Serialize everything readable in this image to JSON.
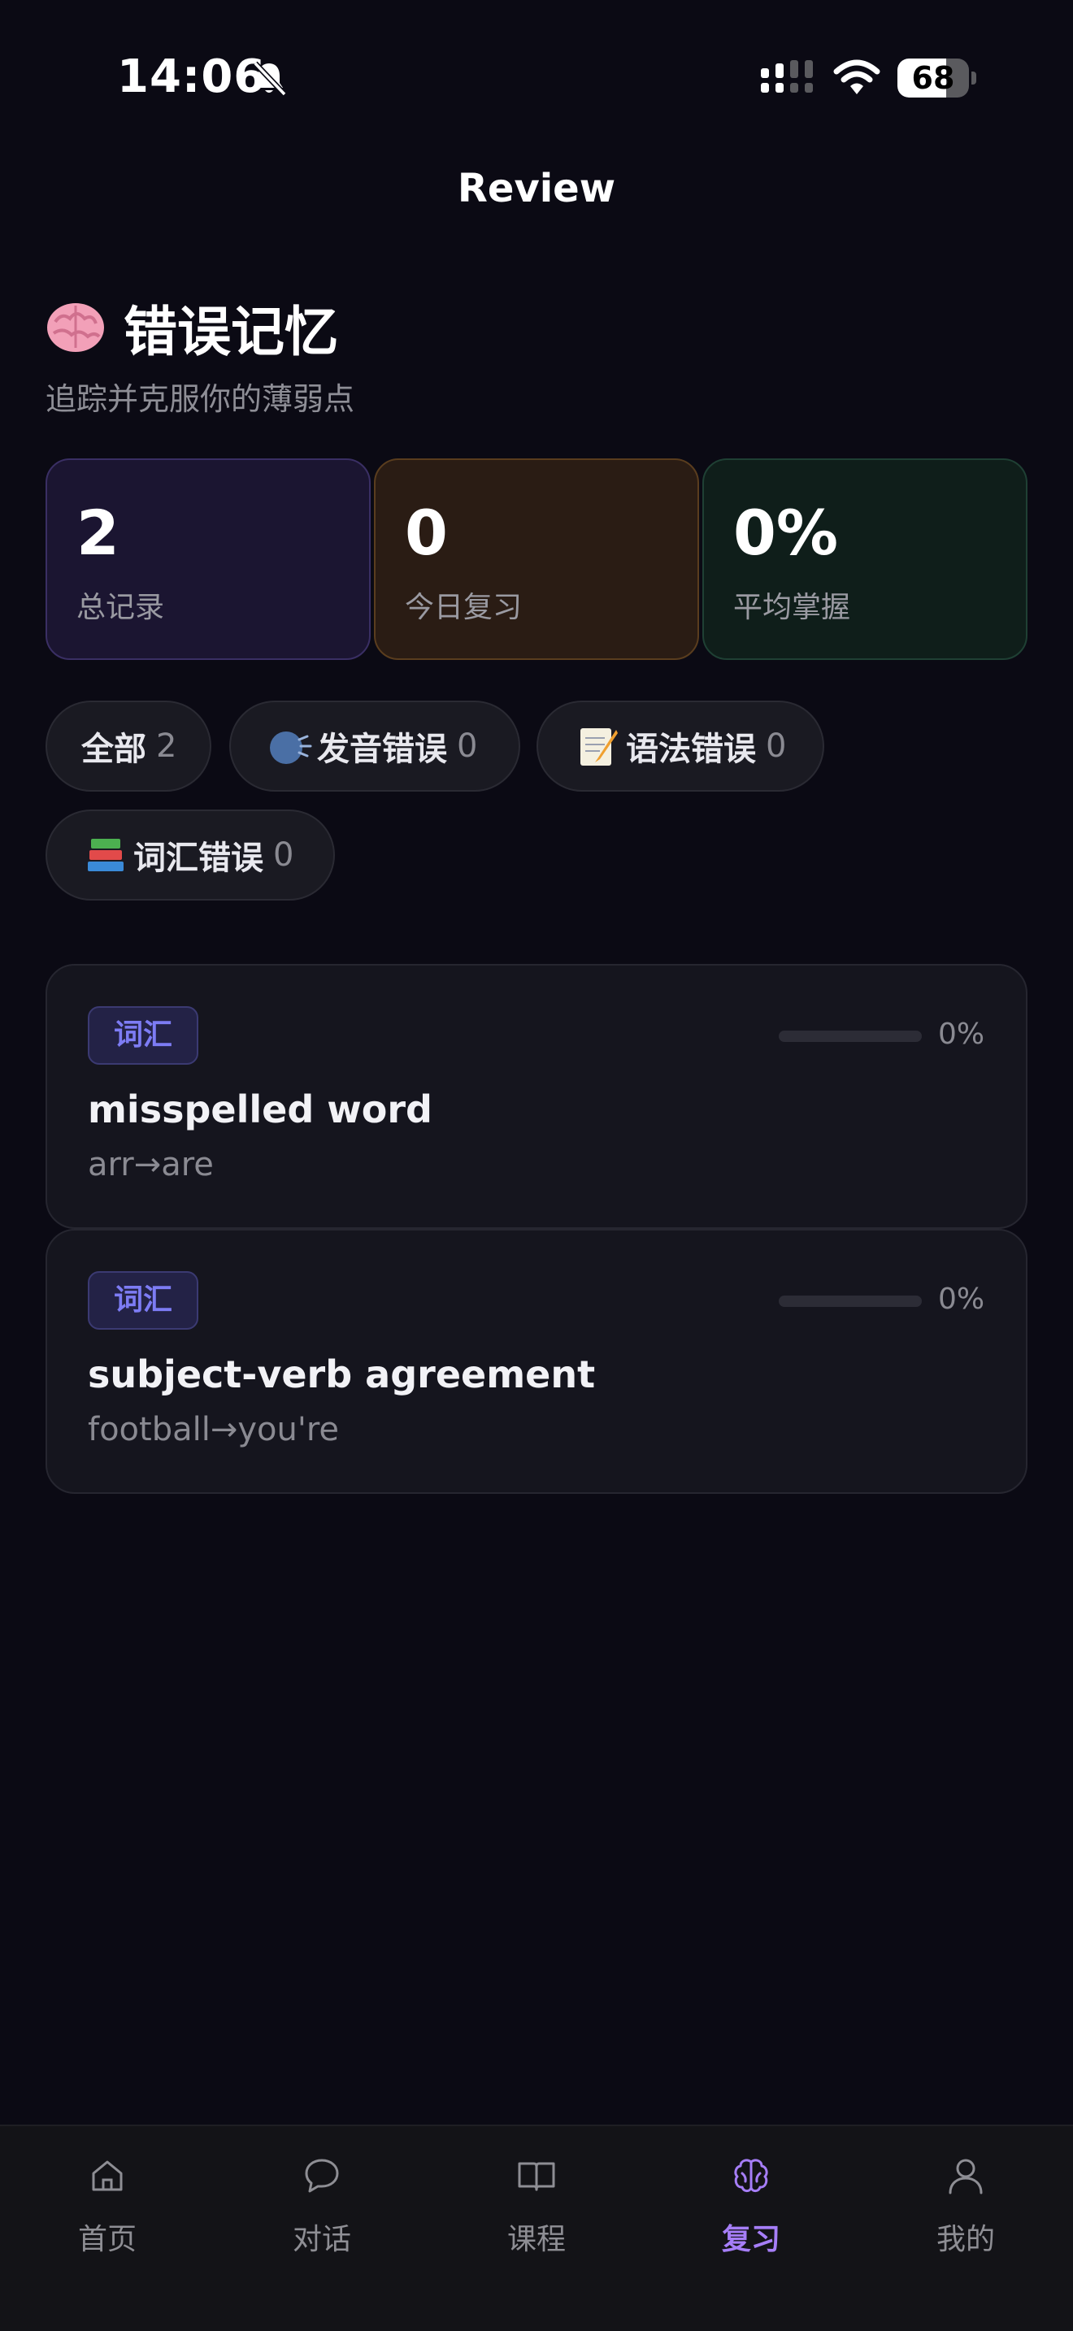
{
  "status_bar": {
    "time": "14:06",
    "battery": {
      "level": 68,
      "text": "68"
    },
    "icons": [
      "bell-slash-icon",
      "cellular-signal-icon",
      "wifi-icon",
      "battery-icon"
    ]
  },
  "nav": {
    "title": "Review"
  },
  "header": {
    "emoji": "brain-emoji",
    "title": "错误记忆",
    "subtitle": "追踪并克服你的薄弱点"
  },
  "stats": [
    {
      "value": "2",
      "label": "总记录",
      "color": "#1b1531"
    },
    {
      "value": "0",
      "label": "今日复习",
      "color": "#2a1c14"
    },
    {
      "value": "0%",
      "label": "平均掌握",
      "color": "#0f1e1a"
    }
  ],
  "filters": [
    {
      "label": "全部",
      "count": "2",
      "icon": ""
    },
    {
      "label": "发音错误",
      "count": "0",
      "icon": "speaking-head-emoji"
    },
    {
      "label": "语法错误",
      "count": "0",
      "icon": "memo-emoji"
    },
    {
      "label": "词汇错误",
      "count": "0",
      "icon": "books-emoji"
    }
  ],
  "records": [
    {
      "tag": "词汇",
      "title": "misspelled word",
      "detail": "arr→are",
      "mastery": 0,
      "mastery_text": "0%"
    },
    {
      "tag": "词汇",
      "title": "subject-verb agreement",
      "detail": "football→you're",
      "mastery": 0,
      "mastery_text": "0%"
    }
  ],
  "tabs": [
    {
      "label": "首页",
      "icon": "home-icon",
      "active": false
    },
    {
      "label": "对话",
      "icon": "chat-bubble-icon",
      "active": false
    },
    {
      "label": "课程",
      "icon": "book-open-icon",
      "active": false
    },
    {
      "label": "复习",
      "icon": "brain-icon",
      "active": true
    },
    {
      "label": "我的",
      "icon": "user-icon",
      "active": false
    }
  ],
  "colors": {
    "background": "#0b0a14",
    "accent": "#a67ef8",
    "tag_accent": "#7d7cf4"
  }
}
